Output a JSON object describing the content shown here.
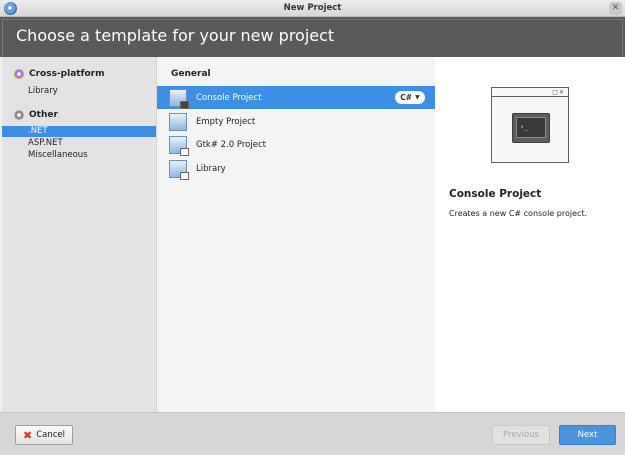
{
  "window": {
    "title": "New Project"
  },
  "header": {
    "title": "Choose a template for your new project"
  },
  "sidebar": {
    "categories": [
      {
        "label": "Cross-platform",
        "items": [
          "Library"
        ]
      },
      {
        "label": "Other",
        "items": [
          ".NET",
          "ASP.NET",
          "Miscellaneous"
        ],
        "selected": ".NET"
      }
    ]
  },
  "templates": {
    "group": "General",
    "items": [
      {
        "label": "Console Project",
        "selected": true,
        "language": "C#"
      },
      {
        "label": "Empty Project"
      },
      {
        "label": "Gtk# 2.0 Project"
      },
      {
        "label": "Library"
      }
    ]
  },
  "detail": {
    "title": "Console Project",
    "description": "Creates a new C# console project.",
    "prompt": "›_"
  },
  "footer": {
    "cancel_label": "Cancel",
    "previous_label": "Previous",
    "next_label": "Next"
  },
  "colors": {
    "accent": "#3d8ee6",
    "header_bg": "#5a5a5a"
  }
}
